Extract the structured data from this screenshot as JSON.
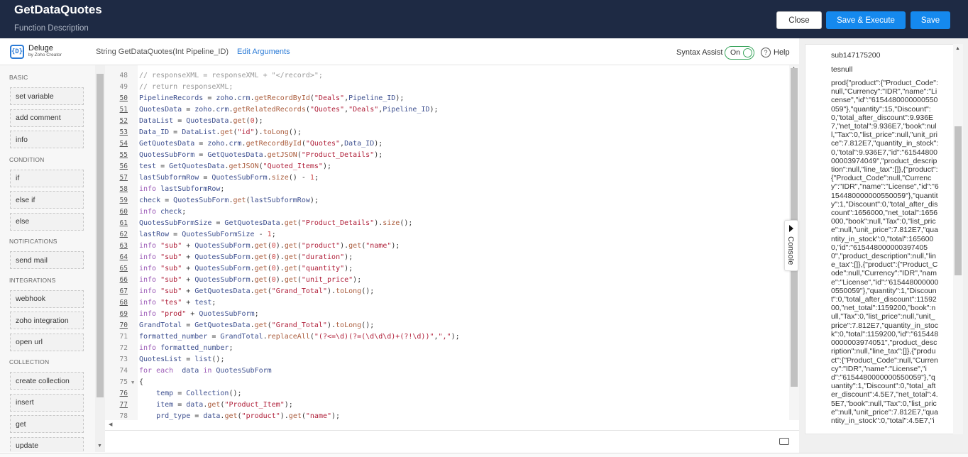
{
  "header": {
    "title": "GetDataQuotes",
    "subtitle": "Function Description",
    "close_label": "Close",
    "save_execute_label": "Save & Execute",
    "save_label": "Save"
  },
  "editor_header": {
    "logo_glyph": "{D}",
    "brand_name": "Deluge",
    "brand_by": "by Zoho Creator",
    "signature": "String  GetDataQuotes(Int Pipeline_ID)",
    "edit_arguments": "Edit Arguments",
    "syntax_assist_label": "Syntax Assist",
    "syntax_assist_state": "On",
    "help_label": "Help"
  },
  "sidebar": {
    "sections": [
      {
        "label": "BASIC",
        "items": [
          "set variable",
          "add comment",
          "info"
        ]
      },
      {
        "label": "CONDITION",
        "items": [
          "if",
          "else if",
          "else"
        ]
      },
      {
        "label": "NOTIFICATIONS",
        "items": [
          "send mail"
        ]
      },
      {
        "label": "INTEGRATIONS",
        "items": [
          "webhook",
          "zoho integration",
          "open url"
        ]
      },
      {
        "label": "COLLECTION",
        "items": [
          "create collection",
          "insert",
          "get",
          "update"
        ]
      }
    ]
  },
  "code": {
    "lines": [
      {
        "n": "48",
        "link": false,
        "fold": false,
        "text": "// responseXML = responseXML + \"</record>\";"
      },
      {
        "n": "49",
        "link": false,
        "fold": false,
        "text": "// return responseXML;"
      },
      {
        "n": "50",
        "link": true,
        "fold": false,
        "text": "PipelineRecords = zoho.crm.getRecordById(\"Deals\",Pipeline_ID);"
      },
      {
        "n": "51",
        "link": true,
        "fold": false,
        "text": "QuotesData = zoho.crm.getRelatedRecords(\"Quotes\",\"Deals\",Pipeline_ID);"
      },
      {
        "n": "52",
        "link": true,
        "fold": false,
        "text": "DataList = QuotesData.get(0);"
      },
      {
        "n": "53",
        "link": true,
        "fold": false,
        "text": "Data_ID = DataList.get(\"id\").toLong();"
      },
      {
        "n": "54",
        "link": true,
        "fold": false,
        "text": "GetQuotesData = zoho.crm.getRecordById(\"Quotes\",Data_ID);"
      },
      {
        "n": "55",
        "link": true,
        "fold": false,
        "text": "QuotesSubForm = GetQuotesData.getJSON(\"Product_Details\");"
      },
      {
        "n": "56",
        "link": true,
        "fold": false,
        "text": "test = GetQuotesData.getJSON(\"Quoted_Items\");"
      },
      {
        "n": "57",
        "link": true,
        "fold": false,
        "text": "lastSubformRow = QuotesSubForm.size() - 1;"
      },
      {
        "n": "58",
        "link": true,
        "fold": false,
        "text": "info lastSubformRow;"
      },
      {
        "n": "59",
        "link": true,
        "fold": false,
        "text": "check = QuotesSubForm.get(lastSubformRow);"
      },
      {
        "n": "60",
        "link": true,
        "fold": false,
        "text": "info check;"
      },
      {
        "n": "61",
        "link": true,
        "fold": false,
        "text": "QuotesSubFormSize = GetQuotesData.get(\"Product_Details\").size();"
      },
      {
        "n": "62",
        "link": true,
        "fold": false,
        "text": "lastRow = QuotesSubFormSize - 1;"
      },
      {
        "n": "63",
        "link": true,
        "fold": false,
        "text": "info \"sub\" + QuotesSubForm.get(0).get(\"product\").get(\"name\");"
      },
      {
        "n": "64",
        "link": true,
        "fold": false,
        "text": "info \"sub\" + QuotesSubForm.get(0).get(\"duration\");"
      },
      {
        "n": "65",
        "link": true,
        "fold": false,
        "text": "info \"sub\" + QuotesSubForm.get(0).get(\"quantity\");"
      },
      {
        "n": "66",
        "link": true,
        "fold": false,
        "text": "info \"sub\" + QuotesSubForm.get(0).get(\"unit_price\");"
      },
      {
        "n": "67",
        "link": true,
        "fold": false,
        "text": "info \"sub\" + GetQuotesData.get(\"Grand_Total\").toLong();"
      },
      {
        "n": "68",
        "link": true,
        "fold": false,
        "text": "info \"tes\" + test;"
      },
      {
        "n": "69",
        "link": true,
        "fold": false,
        "text": "info \"prod\" + QuotesSubForm;"
      },
      {
        "n": "70",
        "link": true,
        "fold": false,
        "text": "GrandTotal = GetQuotesData.get(\"Grand_Total\").toLong();"
      },
      {
        "n": "71",
        "link": false,
        "fold": false,
        "text": "formatted_number = GrandTotal.replaceAll(\"(?<=\\d)(?=(\\d\\d\\d)+(?!\\d))\",\",\");"
      },
      {
        "n": "72",
        "link": false,
        "fold": false,
        "text": "info formatted_number;"
      },
      {
        "n": "73",
        "link": false,
        "fold": false,
        "text": "QuotesList = list();"
      },
      {
        "n": "74",
        "link": false,
        "fold": false,
        "text": "for each  data in QuotesSubForm"
      },
      {
        "n": "75",
        "link": false,
        "fold": true,
        "text": "{"
      },
      {
        "n": "76",
        "link": true,
        "fold": false,
        "text": "    temp = Collection();"
      },
      {
        "n": "77",
        "link": true,
        "fold": false,
        "text": "    item = data.get(\"Product_Item\");"
      },
      {
        "n": "78",
        "link": false,
        "fold": false,
        "text": "    prd_type = data.get(\"product\").get(\"name\");"
      }
    ]
  },
  "console": {
    "tab_label": "Console",
    "line1": "sub147175200",
    "line2": "tesnull",
    "prod": "prod{\"product\":{\"Product_Code\":null,\"Currency\":\"IDR\",\"name\":\"License\",\"id\":\"6154480000000550059\"},\"quantity\":15,\"Discount\":0,\"total_after_discount\":9.936E7,\"net_total\":9.936E7,\"book\":null,\"Tax\":0,\"list_price\":null,\"unit_price\":7.812E7,\"quantity_in_stock\":0,\"total\":9.936E7,\"id\":\"6154480000003974049\",\"product_description\":null,\"line_tax\":[]},{\"product\":{\"Product_Code\":null,\"Currency\":\"IDR\",\"name\":\"License\",\"id\":\"6154480000000550059\"},\"quantity\":1,\"Discount\":0,\"total_after_discount\":1656000,\"net_total\":1656000,\"book\":null,\"Tax\":0,\"list_price\":null,\"unit_price\":7.812E7,\"quantity_in_stock\":0,\"total\":1656000,\"id\":\"6154480000003974050\",\"product_description\":null,\"line_tax\":[]},{\"product\":{\"Product_Code\":null,\"Currency\":\"IDR\",\"name\":\"License\",\"id\":\"6154480000000550059\"},\"quantity\":1,\"Discount\":0,\"total_after_discount\":1159200,\"net_total\":1159200,\"book\":null,\"Tax\":0,\"list_price\":null,\"unit_price\":7.812E7,\"quantity_in_stock\":0,\"total\":1159200,\"id\":\"6154480000003974051\",\"product_description\":null,\"line_tax\":[]},{\"product\":{\"Product_Code\":null,\"Currency\":\"IDR\",\"name\":\"License\",\"id\":\"6154480000000550059\"},\"quantity\":1,\"Discount\":0,\"total_after_discount\":4.5E7,\"net_total\":4.5E7,\"book\":null,\"Tax\":0,\"list_price\":null,\"unit_price\":7.812E7,\"quantity_in_stock\":0,\"total\":4.5E7,\"i"
  },
  "colors": {
    "topbar": "#1e2a44",
    "primary_button": "#1589ee",
    "toggle_on": "#3aa55d",
    "link": "#2a7ad6"
  },
  "icons": {
    "help": "help-circle-icon",
    "console_toggle": "triangle-right-icon",
    "keyboard": "keyboard-icon",
    "logo": "deluge-logo-icon"
  }
}
